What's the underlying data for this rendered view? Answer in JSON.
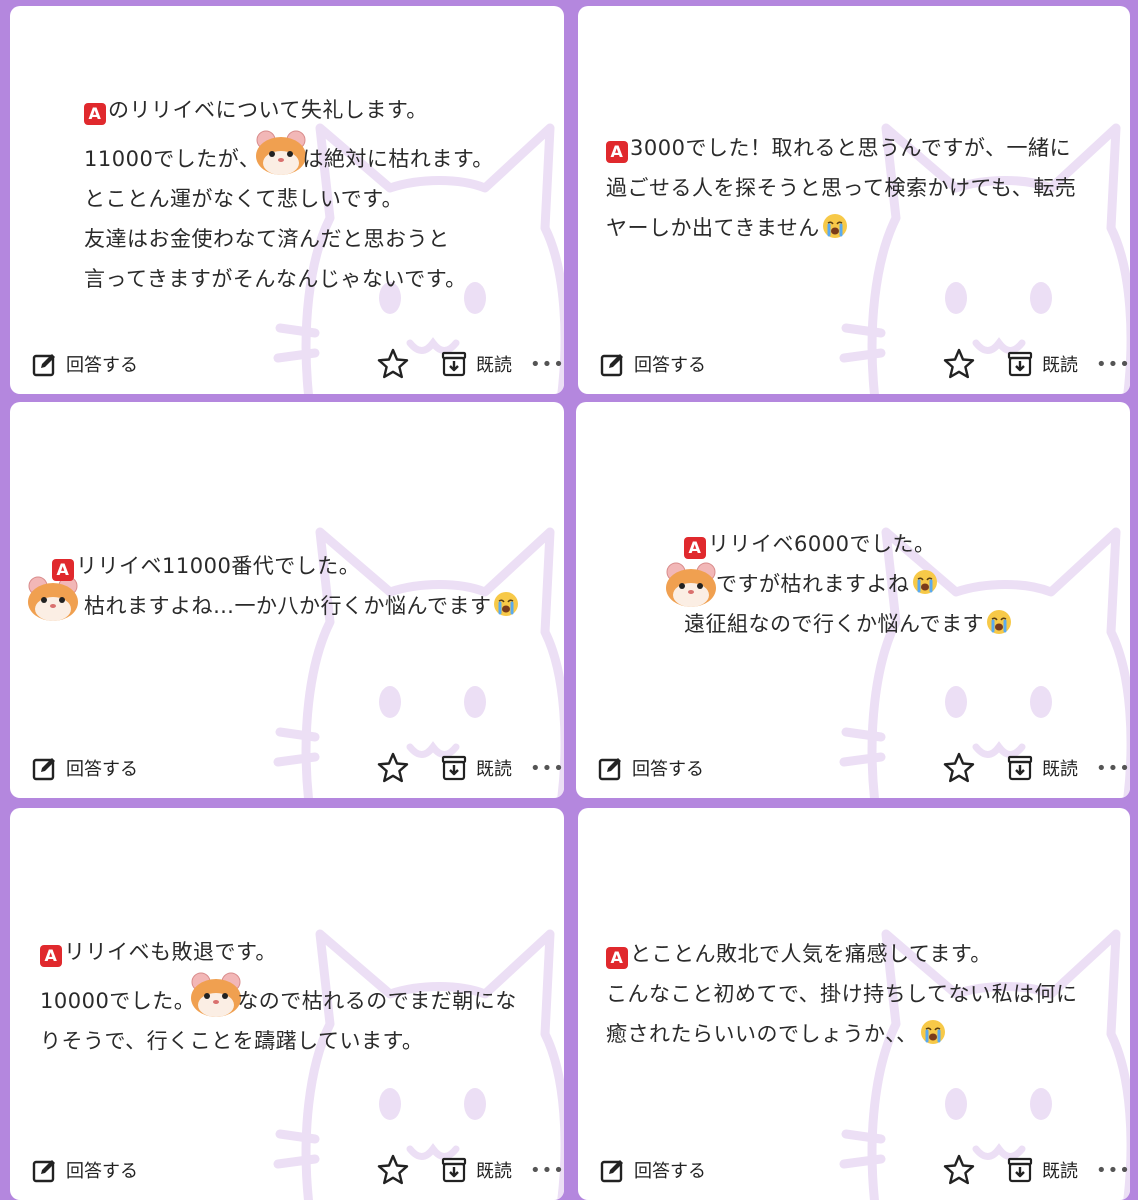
{
  "footer": {
    "answer_label": "回答する",
    "read_label": "既読"
  },
  "icons": {
    "answer": "edit-icon",
    "star": "star-icon",
    "read": "archive-icon",
    "more": "more-dots-icon",
    "badge": "letter-a-badge",
    "hamster": "hamster-emoji",
    "cry": "crying-face-emoji"
  },
  "colors": {
    "background": "#b487de",
    "card": "#ffffff",
    "badge": "#e0292d",
    "watermark": "#ecdff5"
  },
  "badge_letter": "A",
  "cards": [
    {
      "lines": [
        "のリリイベについて失礼します。",
        "11000でしたが、",
        "は絶対に枯れます。",
        "とことん運がなくて悲しいです。",
        "友達はお金使わなて済んだと思おうと",
        "言ってきますがそんなんじゃないです。"
      ]
    },
    {
      "lines": [
        "3000でした！取れると思うんですが、一緒に",
        "過ごせる人を探そうと思って検索かけても、転売",
        "ヤーしか出てきません"
      ]
    },
    {
      "lines": [
        "リリイベ11000番代でした。",
        "枯れますよね…一か八か行くか悩んでます"
      ]
    },
    {
      "lines": [
        "リリイベ6000でした。",
        "ですが枯れますよね",
        "遠征組なので行くか悩んでます"
      ]
    },
    {
      "lines": [
        "リリイベも敗退です。",
        "10000でした。",
        "なので枯れるのでまだ朝にな",
        "りそうで、行くことを躊躇しています。"
      ]
    },
    {
      "lines": [
        "とことん敗北で人気を痛感してます。",
        "こんなこと初めてで、掛け持ちしてない私は何に",
        "癒されたらいいのでしょうか、、"
      ]
    }
  ]
}
